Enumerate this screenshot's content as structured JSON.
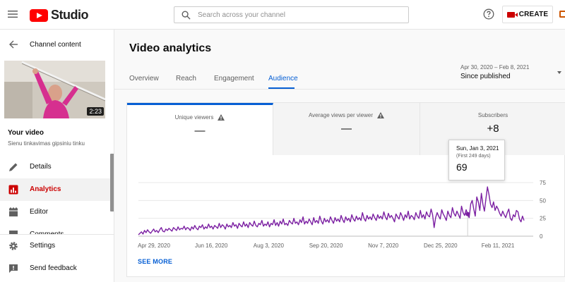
{
  "header": {
    "logo_text": "Studio",
    "search_placeholder": "Search across your channel",
    "create_label": "CREATE"
  },
  "sidebar": {
    "back_label": "Channel content",
    "thumbnail_duration": "2:23",
    "video_title": "Your video",
    "video_subtitle": "Sienu tinkavimas gipsiniu tinku",
    "items": [
      {
        "label": "Details",
        "icon": "pencil-icon"
      },
      {
        "label": "Analytics",
        "icon": "analytics-icon",
        "active": true
      },
      {
        "label": "Editor",
        "icon": "film-icon"
      },
      {
        "label": "Comments",
        "icon": "comments-icon"
      }
    ],
    "bottom_items": [
      {
        "label": "Settings",
        "icon": "gear-icon"
      },
      {
        "label": "Send feedback",
        "icon": "feedback-icon"
      }
    ]
  },
  "main": {
    "title": "Video analytics",
    "tabs": [
      {
        "label": "Overview"
      },
      {
        "label": "Reach"
      },
      {
        "label": "Engagement"
      },
      {
        "label": "Audience",
        "active": true
      }
    ],
    "date_range": "Apr 30, 2020 – Feb 8, 2021",
    "date_selection": "Since published",
    "metrics": [
      {
        "label": "Unique viewers",
        "value": "—",
        "warning": true,
        "active": true
      },
      {
        "label": "Average views per viewer",
        "value": "—",
        "warning": true
      },
      {
        "label": "Subscribers",
        "value": "+8"
      }
    ],
    "tooltip": {
      "date": "Sun, Jan 3, 2021",
      "sub": "(First 249 days)",
      "value": "69"
    },
    "see_more_label": "SEE MORE"
  },
  "colors": {
    "accent_blue": "#065fd4",
    "active_red": "#cc0000",
    "line_purple": "#7b1fa2"
  },
  "chart_data": {
    "type": "line",
    "series": [
      {
        "values": [
          2,
          4,
          6,
          3,
          8,
          5,
          9,
          6,
          4,
          7,
          10,
          6,
          8,
          5,
          9,
          12,
          7,
          6,
          10,
          8,
          11,
          9,
          7,
          12,
          10,
          8,
          13,
          9,
          11,
          10,
          14,
          9,
          12,
          11,
          8,
          13,
          10,
          15,
          11,
          9,
          14,
          12,
          16,
          10,
          13,
          11,
          17,
          12,
          14,
          10,
          15,
          13,
          11,
          18,
          12,
          16,
          14,
          10,
          17,
          13,
          15,
          12,
          19,
          14,
          16,
          11,
          18,
          15,
          13,
          20,
          14,
          17,
          12,
          19,
          16,
          14,
          21,
          15,
          13,
          18,
          16,
          22,
          14,
          17,
          15,
          20,
          13,
          18,
          16,
          23,
          15,
          19,
          14,
          21,
          17,
          24,
          16,
          18,
          15,
          22,
          19,
          17,
          25,
          18,
          20,
          16,
          23,
          19,
          27,
          17,
          21,
          18,
          24,
          20,
          16,
          26,
          19,
          22,
          18,
          28,
          21,
          17,
          25,
          20,
          23,
          19,
          27,
          22,
          18,
          26,
          21,
          24,
          20,
          29,
          23,
          19,
          27,
          22,
          25,
          20,
          30,
          24,
          21,
          28,
          23,
          26,
          22,
          33,
          25,
          21,
          29,
          24,
          27,
          23,
          31,
          26,
          22,
          30,
          25,
          28,
          24,
          34,
          27,
          23,
          32,
          26,
          29,
          25,
          20,
          31,
          27,
          24,
          33,
          28,
          22,
          30,
          26,
          35,
          24,
          29,
          27,
          23,
          33,
          28,
          25,
          36,
          26,
          30,
          24,
          34,
          29,
          27,
          38,
          30,
          12,
          26,
          33,
          28,
          24,
          37,
          31,
          27,
          22,
          35,
          29,
          26,
          40,
          32,
          28,
          35,
          30,
          25,
          42,
          33,
          29,
          37,
          31,
          26,
          45,
          50,
          38,
          28,
          55,
          48,
          36,
          60,
          45,
          35,
          52,
          69,
          58,
          45,
          40,
          48,
          36,
          42,
          38,
          32,
          28,
          35,
          30,
          26,
          33,
          38,
          25,
          22,
          30,
          27,
          36,
          34,
          24,
          20,
          28,
          22
        ],
        "stroke": "#7b1fa2"
      }
    ],
    "x_tick_labels": [
      "Apr 29, 2020",
      "Jun 16, 2020",
      "Aug 3, 2020",
      "Sep 20, 2020",
      "Nov 7, 2020",
      "Dec 25, 2020",
      "Feb 11, 2021"
    ],
    "y_tick_labels": [
      "75",
      "50",
      "25",
      "0"
    ],
    "ylim": [
      0,
      75
    ],
    "highlight_index": 216,
    "grid": true,
    "legend": "none"
  }
}
